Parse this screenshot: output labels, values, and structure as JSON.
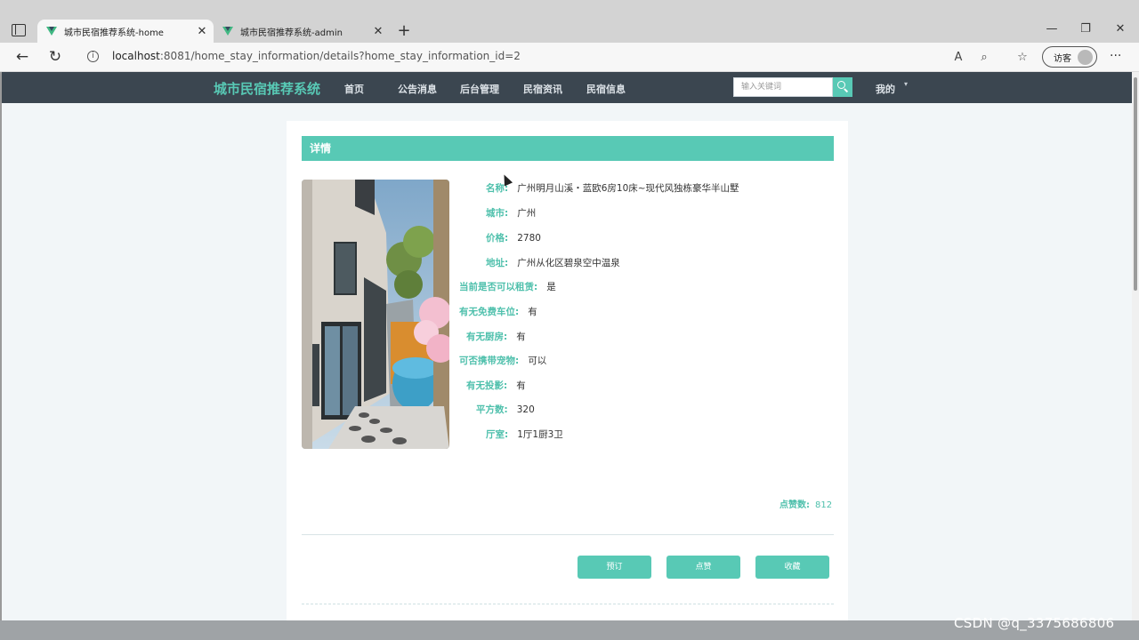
{
  "browser": {
    "tabs": [
      {
        "title": "城市民宿推荐系统-home",
        "active": true
      },
      {
        "title": "城市民宿推荐系统-admin",
        "active": false
      }
    ],
    "new_tab": "+",
    "close_glyph": "✕",
    "win_controls": [
      "—",
      "❐",
      "✕"
    ],
    "url_host": "localhost",
    "url_rest": ":8081/home_stay_information/details?home_stay_information_id=2",
    "guest_label": "访客",
    "more_glyph": "···"
  },
  "site": {
    "brand": "城市民宿推荐系统",
    "menu": [
      "首页",
      "公告消息",
      "后台管理",
      "民宿资讯",
      "民宿信息"
    ],
    "search_placeholder": "输入关键词",
    "mine": "我的",
    "mine_caret": "▾"
  },
  "detail": {
    "section_title": "详情",
    "fields": [
      {
        "label": "名称:",
        "value": "广州明月山溪・蓝欧6房10床~现代风独栋豪华半山墅"
      },
      {
        "label": "城市:",
        "value": "广州"
      },
      {
        "label": "价格:",
        "value": "2780"
      },
      {
        "label": "地址:",
        "value": "广州从化区碧泉空中温泉"
      },
      {
        "label": "当前是否可以租赁:",
        "value": "是"
      },
      {
        "label": "有无免费车位:",
        "value": "有"
      },
      {
        "label": "有无厨房:",
        "value": "有"
      },
      {
        "label": "可否携带宠物:",
        "value": "可以"
      },
      {
        "label": "有无投影:",
        "value": "有"
      },
      {
        "label": "平方数:",
        "value": "320"
      },
      {
        "label": "厅室:",
        "value": "1厅1厨3卫"
      }
    ],
    "likes_label": "点赞数:",
    "likes_value": "812",
    "buttons": [
      "预订",
      "点赞",
      "收藏"
    ]
  },
  "watermark": "CSDN @q_3375686806",
  "colors": {
    "accent": "#58c9b5",
    "header_bg": "#3b4650",
    "label": "#4fc0ac"
  }
}
